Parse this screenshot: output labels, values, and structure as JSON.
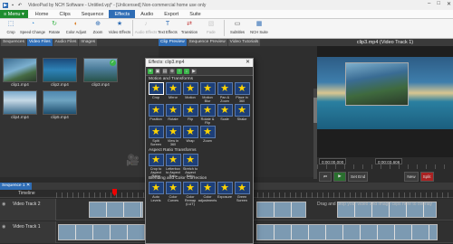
{
  "window": {
    "title": "VideoPad by NCH Software - Untitled.vpj* - [Unlicensed] Non-commercial home use only",
    "controls": [
      "–",
      "□",
      "✕"
    ]
  },
  "menubar": {
    "menu_label": "≡ Menu ▾",
    "tabs": [
      "Home",
      "Clips",
      "Sequence",
      "Effects",
      "Audio",
      "Export",
      "Suite"
    ],
    "active_tab": "Effects"
  },
  "ribbon": {
    "buttons": [
      {
        "label": "Crop",
        "icon": "crop-icon",
        "glyph": "⬚",
        "color": "#2f6db5"
      },
      {
        "label": "Speed Change",
        "icon": "speed-icon",
        "glyph": "◔",
        "color": "#3a8fd6"
      },
      {
        "label": "Rotate",
        "icon": "rotate-icon",
        "glyph": "↻",
        "color": "#3bb54a"
      },
      {
        "label": "Color Adjust",
        "icon": "color-adjust-icon",
        "glyph": "◐",
        "color": "#d97a1e"
      },
      {
        "label": "Zoom",
        "icon": "zoom-icon",
        "glyph": "⊕",
        "color": "#2f6db5"
      },
      {
        "label": "Video Effects",
        "icon": "video-effects-icon",
        "glyph": "★",
        "color": "#2f6db5"
      },
      {
        "label": "Audio Effects",
        "icon": "audio-effects-icon",
        "glyph": "♪",
        "color": "#cccccc",
        "dim": true
      },
      {
        "label": "Text Effects",
        "icon": "text-effects-icon",
        "glyph": "T",
        "color": "#2f6db5"
      },
      {
        "label": "Transition",
        "icon": "transition-icon",
        "glyph": "⇄",
        "color": "#c23636"
      },
      {
        "label": "Fade",
        "icon": "fade-icon",
        "glyph": "▧",
        "color": "#cccccc",
        "dim": true
      },
      {
        "label": "Subtitles",
        "icon": "subtitles-icon",
        "glyph": "▭",
        "color": "#555555"
      },
      {
        "label": "NCH Suite",
        "icon": "nch-suite-icon",
        "glyph": "▦",
        "color": "#2f6db5"
      }
    ]
  },
  "left_panel": {
    "tabs": [
      "Sequences",
      "Video Files",
      "Audio Files",
      "Images"
    ],
    "active_tab": "Video Files",
    "clips": [
      {
        "name": "clip1.mp4",
        "style": "t1"
      },
      {
        "name": "clip2.mp4",
        "style": "t2",
        "plus": true
      },
      {
        "name": "clip3.mp4",
        "style": "t3",
        "check": true
      },
      {
        "name": "clip4.mp4",
        "style": "t4"
      },
      {
        "name": "clip5.mp4",
        "style": "t5"
      }
    ]
  },
  "mid_panel": {
    "tabs": [
      "Clip Preview",
      "Sequence Preview",
      "Video Tutorials"
    ],
    "active_tab": "Clip Preview"
  },
  "preview": {
    "clip_title": "clip3.mp4 (Video Track 1)",
    "time_left": "0:00:00.000",
    "time_right": "0:00:03.606",
    "buttons": [
      "⏮",
      "▶",
      "Set End",
      "New",
      "Split"
    ]
  },
  "effects_dialog": {
    "title": "Effects: clip3.mp4",
    "close": "✕",
    "toolbar": [
      "+",
      "▣",
      "▤",
      "⊗",
      "↑",
      "↓",
      "▶"
    ],
    "sections": [
      {
        "name": "Motion and Transforms",
        "effects": [
          "Crop",
          "Mirror",
          "Motion",
          "Motion Blur",
          "Pan & Zoom",
          "Place in 360",
          "Position",
          "Rotate",
          "Flip",
          "Rotate & Flip",
          "Scale",
          "Shake",
          "Split Screen",
          "View in 360",
          "Wrap",
          "Zoom"
        ]
      },
      {
        "name": "Aspect Ratio Transforms",
        "effects": [
          "Crop to Aspect Ratio",
          "Letterbox to Aspect Ratio",
          "Stretch to Aspect Ratio"
        ]
      },
      {
        "name": "Blending and Color Correction",
        "effects": [
          "Auto Levels",
          "Color Curves",
          "Color Remap (LUT)",
          "Color adjustments",
          "Exposure",
          "Green Screen"
        ]
      }
    ]
  },
  "timeline": {
    "sequence_tab": "Sequence 1 ✕",
    "label": "Timeline",
    "tracks": [
      {
        "name": "Video Track 2",
        "hint": "Drag and drop your video and image clips here to overlay"
      },
      {
        "name": "Video Track 1",
        "hint": ""
      }
    ]
  }
}
